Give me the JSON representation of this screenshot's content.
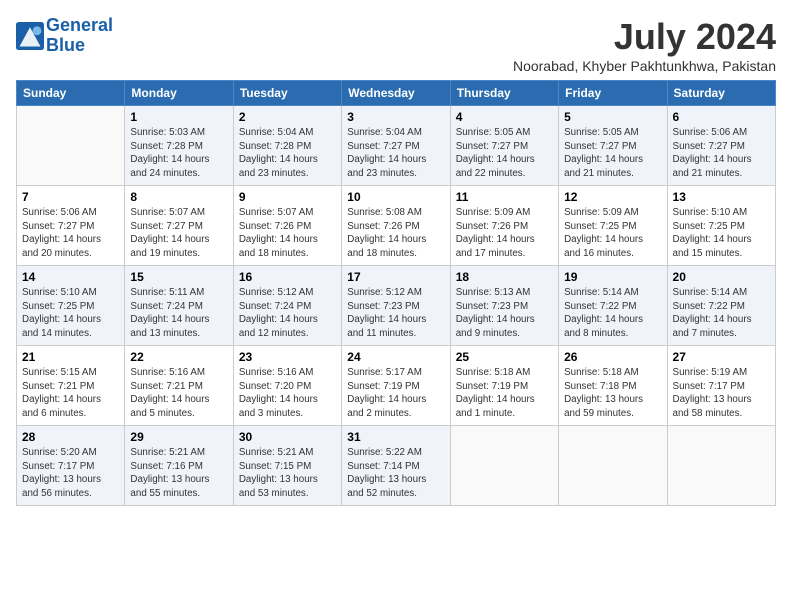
{
  "header": {
    "logo_line1": "General",
    "logo_line2": "Blue",
    "month": "July 2024",
    "location": "Noorabad, Khyber Pakhtunkhwa, Pakistan"
  },
  "weekdays": [
    "Sunday",
    "Monday",
    "Tuesday",
    "Wednesday",
    "Thursday",
    "Friday",
    "Saturday"
  ],
  "weeks": [
    [
      {
        "day": "",
        "detail": ""
      },
      {
        "day": "1",
        "detail": "Sunrise: 5:03 AM\nSunset: 7:28 PM\nDaylight: 14 hours\nand 24 minutes."
      },
      {
        "day": "2",
        "detail": "Sunrise: 5:04 AM\nSunset: 7:28 PM\nDaylight: 14 hours\nand 23 minutes."
      },
      {
        "day": "3",
        "detail": "Sunrise: 5:04 AM\nSunset: 7:27 PM\nDaylight: 14 hours\nand 23 minutes."
      },
      {
        "day": "4",
        "detail": "Sunrise: 5:05 AM\nSunset: 7:27 PM\nDaylight: 14 hours\nand 22 minutes."
      },
      {
        "day": "5",
        "detail": "Sunrise: 5:05 AM\nSunset: 7:27 PM\nDaylight: 14 hours\nand 21 minutes."
      },
      {
        "day": "6",
        "detail": "Sunrise: 5:06 AM\nSunset: 7:27 PM\nDaylight: 14 hours\nand 21 minutes."
      }
    ],
    [
      {
        "day": "7",
        "detail": "Sunrise: 5:06 AM\nSunset: 7:27 PM\nDaylight: 14 hours\nand 20 minutes."
      },
      {
        "day": "8",
        "detail": "Sunrise: 5:07 AM\nSunset: 7:27 PM\nDaylight: 14 hours\nand 19 minutes."
      },
      {
        "day": "9",
        "detail": "Sunrise: 5:07 AM\nSunset: 7:26 PM\nDaylight: 14 hours\nand 18 minutes."
      },
      {
        "day": "10",
        "detail": "Sunrise: 5:08 AM\nSunset: 7:26 PM\nDaylight: 14 hours\nand 18 minutes."
      },
      {
        "day": "11",
        "detail": "Sunrise: 5:09 AM\nSunset: 7:26 PM\nDaylight: 14 hours\nand 17 minutes."
      },
      {
        "day": "12",
        "detail": "Sunrise: 5:09 AM\nSunset: 7:25 PM\nDaylight: 14 hours\nand 16 minutes."
      },
      {
        "day": "13",
        "detail": "Sunrise: 5:10 AM\nSunset: 7:25 PM\nDaylight: 14 hours\nand 15 minutes."
      }
    ],
    [
      {
        "day": "14",
        "detail": "Sunrise: 5:10 AM\nSunset: 7:25 PM\nDaylight: 14 hours\nand 14 minutes."
      },
      {
        "day": "15",
        "detail": "Sunrise: 5:11 AM\nSunset: 7:24 PM\nDaylight: 14 hours\nand 13 minutes."
      },
      {
        "day": "16",
        "detail": "Sunrise: 5:12 AM\nSunset: 7:24 PM\nDaylight: 14 hours\nand 12 minutes."
      },
      {
        "day": "17",
        "detail": "Sunrise: 5:12 AM\nSunset: 7:23 PM\nDaylight: 14 hours\nand 11 minutes."
      },
      {
        "day": "18",
        "detail": "Sunrise: 5:13 AM\nSunset: 7:23 PM\nDaylight: 14 hours\nand 9 minutes."
      },
      {
        "day": "19",
        "detail": "Sunrise: 5:14 AM\nSunset: 7:22 PM\nDaylight: 14 hours\nand 8 minutes."
      },
      {
        "day": "20",
        "detail": "Sunrise: 5:14 AM\nSunset: 7:22 PM\nDaylight: 14 hours\nand 7 minutes."
      }
    ],
    [
      {
        "day": "21",
        "detail": "Sunrise: 5:15 AM\nSunset: 7:21 PM\nDaylight: 14 hours\nand 6 minutes."
      },
      {
        "day": "22",
        "detail": "Sunrise: 5:16 AM\nSunset: 7:21 PM\nDaylight: 14 hours\nand 5 minutes."
      },
      {
        "day": "23",
        "detail": "Sunrise: 5:16 AM\nSunset: 7:20 PM\nDaylight: 14 hours\nand 3 minutes."
      },
      {
        "day": "24",
        "detail": "Sunrise: 5:17 AM\nSunset: 7:19 PM\nDaylight: 14 hours\nand 2 minutes."
      },
      {
        "day": "25",
        "detail": "Sunrise: 5:18 AM\nSunset: 7:19 PM\nDaylight: 14 hours\nand 1 minute."
      },
      {
        "day": "26",
        "detail": "Sunrise: 5:18 AM\nSunset: 7:18 PM\nDaylight: 13 hours\nand 59 minutes."
      },
      {
        "day": "27",
        "detail": "Sunrise: 5:19 AM\nSunset: 7:17 PM\nDaylight: 13 hours\nand 58 minutes."
      }
    ],
    [
      {
        "day": "28",
        "detail": "Sunrise: 5:20 AM\nSunset: 7:17 PM\nDaylight: 13 hours\nand 56 minutes."
      },
      {
        "day": "29",
        "detail": "Sunrise: 5:21 AM\nSunset: 7:16 PM\nDaylight: 13 hours\nand 55 minutes."
      },
      {
        "day": "30",
        "detail": "Sunrise: 5:21 AM\nSunset: 7:15 PM\nDaylight: 13 hours\nand 53 minutes."
      },
      {
        "day": "31",
        "detail": "Sunrise: 5:22 AM\nSunset: 7:14 PM\nDaylight: 13 hours\nand 52 minutes."
      },
      {
        "day": "",
        "detail": ""
      },
      {
        "day": "",
        "detail": ""
      },
      {
        "day": "",
        "detail": ""
      }
    ]
  ]
}
